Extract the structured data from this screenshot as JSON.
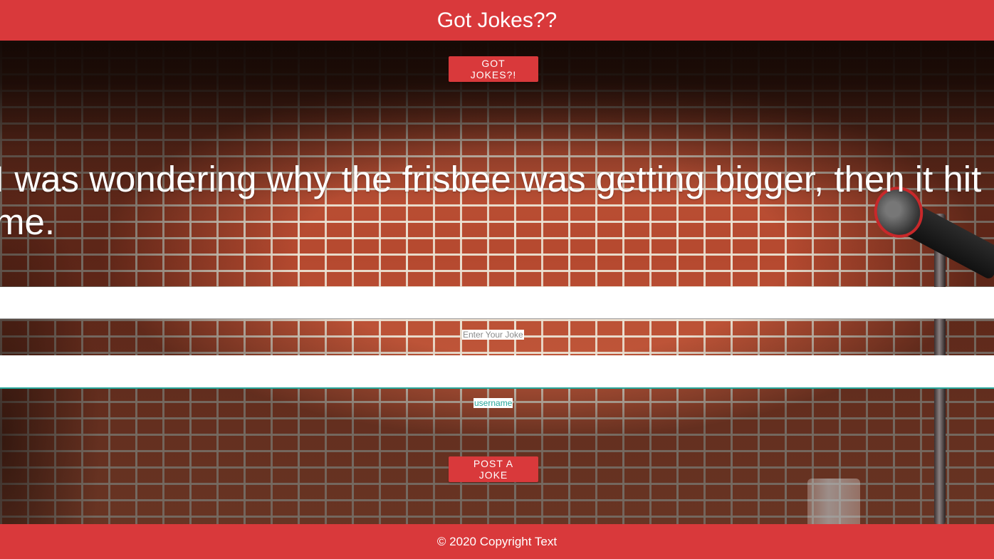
{
  "header": {
    "title": "Got Jokes??"
  },
  "hero": {
    "got_jokes_button": "GOT JOKES?!",
    "joke_text": "I was wondering why the frisbee was getting bigger, then it hit me."
  },
  "form": {
    "joke_field": {
      "label": "Enter Your Joke",
      "value": ""
    },
    "username_field": {
      "label": "username",
      "value": ""
    },
    "post_button": "POST A JOKE"
  },
  "footer": {
    "copyright": "© 2020 Copyright Text"
  },
  "colors": {
    "brand_red": "#d9393b",
    "input_focus": "#26a69a",
    "text_on_brand": "#ffffff"
  }
}
